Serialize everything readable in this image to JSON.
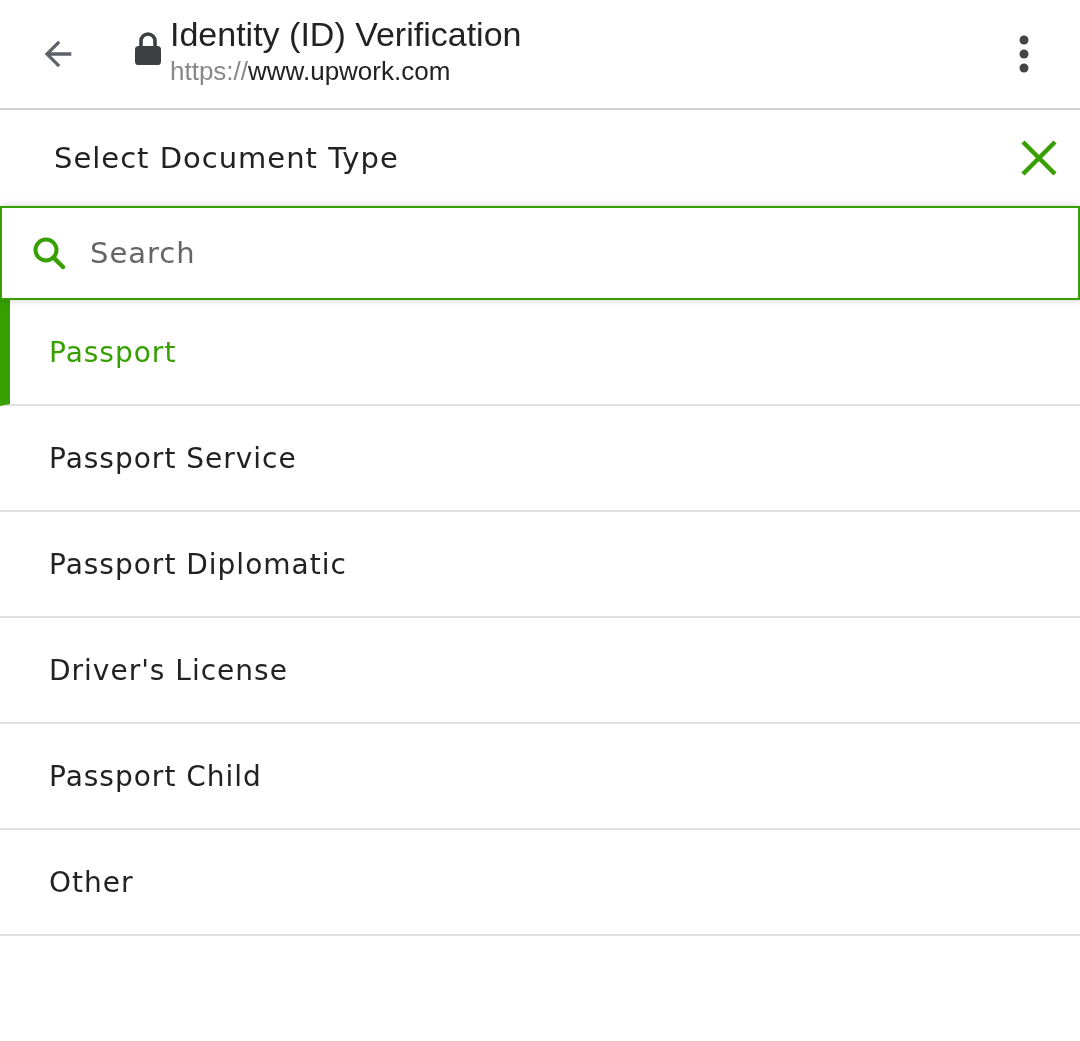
{
  "browser_bar": {
    "title": "Identity (ID) Verification",
    "url": {
      "scheme": "https://",
      "host": "www.upwork.com"
    }
  },
  "dialog": {
    "title": "Select Document Type",
    "search": {
      "placeholder": "Search"
    },
    "options": [
      {
        "label": "Passport",
        "selected": true
      },
      {
        "label": "Passport Service",
        "selected": false
      },
      {
        "label": "Passport Diplomatic",
        "selected": false
      },
      {
        "label": "Driver's License",
        "selected": false
      },
      {
        "label": "Passport Child",
        "selected": false
      },
      {
        "label": "Other",
        "selected": false
      }
    ]
  }
}
